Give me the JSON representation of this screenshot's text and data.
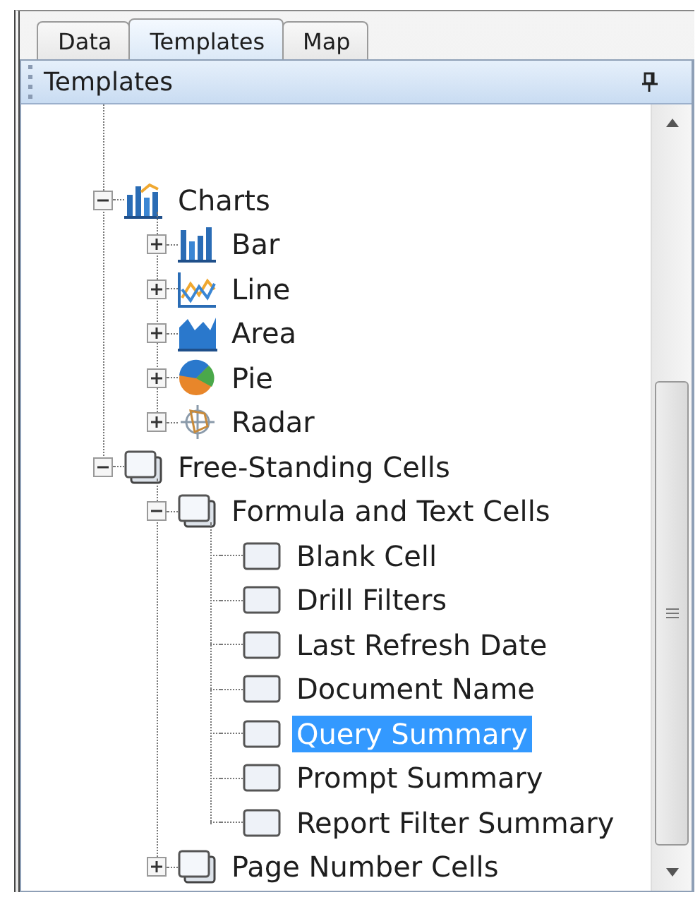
{
  "tabs": [
    {
      "label": "Data",
      "selected": false
    },
    {
      "label": "Templates",
      "selected": true
    },
    {
      "label": "Map",
      "selected": false
    }
  ],
  "panel": {
    "title": "Templates"
  },
  "tree": [
    {
      "label": "Charts",
      "kind": "charts",
      "expanded": true,
      "selected": false,
      "children": [
        {
          "label": "Bar",
          "kind": "bar",
          "expanded": false,
          "selected": false
        },
        {
          "label": "Line",
          "kind": "line",
          "expanded": false,
          "selected": false
        },
        {
          "label": "Area",
          "kind": "area",
          "expanded": false,
          "selected": false
        },
        {
          "label": "Pie",
          "kind": "pie",
          "expanded": false,
          "selected": false
        },
        {
          "label": "Radar",
          "kind": "radar",
          "expanded": false,
          "selected": false
        }
      ]
    },
    {
      "label": "Free-Standing Cells",
      "kind": "cells",
      "expanded": true,
      "selected": false,
      "children": [
        {
          "label": "Formula and Text Cells",
          "kind": "cells",
          "expanded": true,
          "selected": false,
          "children": [
            {
              "label": "Blank Cell",
              "kind": "cell",
              "selected": false
            },
            {
              "label": "Drill Filters",
              "kind": "cell",
              "selected": false
            },
            {
              "label": "Last Refresh Date",
              "kind": "cell",
              "selected": false
            },
            {
              "label": "Document Name",
              "kind": "cell",
              "selected": false
            },
            {
              "label": "Query Summary",
              "kind": "cell",
              "selected": true
            },
            {
              "label": "Prompt Summary",
              "kind": "cell",
              "selected": false
            },
            {
              "label": "Report Filter Summary",
              "kind": "cell",
              "selected": false
            }
          ]
        },
        {
          "label": "Page Number Cells",
          "kind": "cells",
          "expanded": false,
          "selected": false
        }
      ]
    }
  ]
}
